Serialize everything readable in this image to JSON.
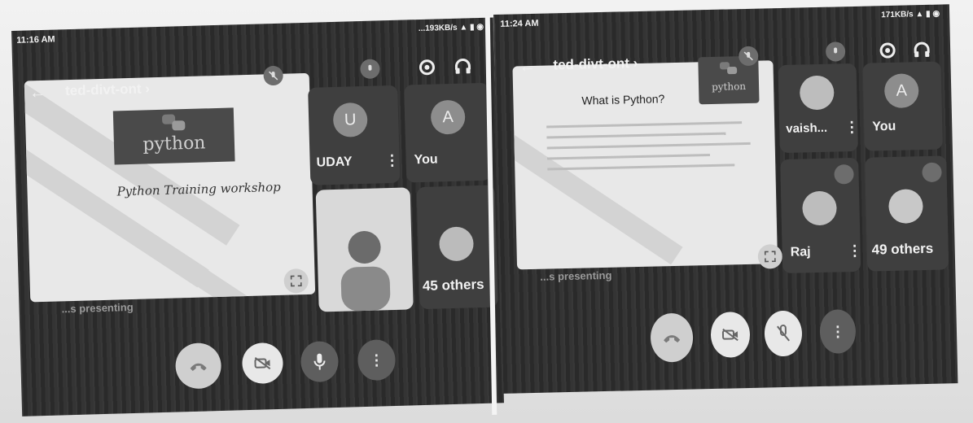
{
  "left": {
    "status_time": "11:16 AM",
    "status_right": "...193KB/s",
    "meeting_title": "ted-divt-ont",
    "title_chevron": "›",
    "slide_banner": "python",
    "slide_caption": "Python Training workshop",
    "participants": [
      {
        "initial": "U",
        "name": "UDAY"
      },
      {
        "initial": "A",
        "name": "You"
      }
    ],
    "others_label": "45 others",
    "presenter_label": "...s presenting",
    "icons": [
      "back-arrow-icon",
      "switch-camera-icon",
      "headphones-icon",
      "mic-off-icon",
      "fullscreen-icon",
      "end-call-icon",
      "camera-off-icon",
      "mic-icon",
      "more-icon"
    ]
  },
  "right": {
    "status_time": "11:24 AM",
    "status_right": "171KB/s",
    "meeting_title": "ted-divt-ont",
    "title_chevron": "›",
    "slide_heading": "What is Python?",
    "slide_banner": "python",
    "participants": [
      {
        "initial": "",
        "name": "vaish..."
      },
      {
        "initial": "A",
        "name": "You"
      },
      {
        "initial": "",
        "name": "Raj"
      }
    ],
    "others_label": "49 others",
    "presenter_label": "...s presenting",
    "icons": [
      "back-arrow-icon",
      "switch-camera-icon",
      "headphones-icon",
      "mic-off-icon",
      "fullscreen-icon",
      "end-call-icon",
      "camera-off-icon",
      "mic-off-icon",
      "more-icon"
    ]
  },
  "colors": {
    "end_call": "#cfcfcf",
    "button_light": "#e8e8e8",
    "tile_bg": "#3f3f3f"
  }
}
